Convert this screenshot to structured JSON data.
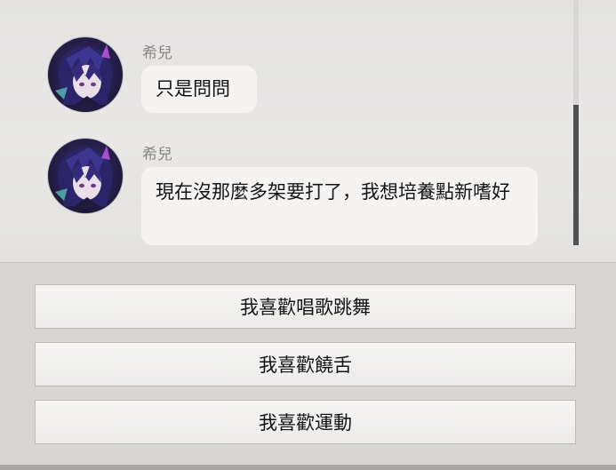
{
  "messages": [
    {
      "sender": "希兒",
      "text": "只是問問",
      "avatar_icon": "character-avatar"
    },
    {
      "sender": "希兒",
      "text": "現在沒那麼多架要打了，我想培養點新嗜好",
      "avatar_icon": "character-avatar"
    }
  ],
  "options": [
    {
      "label": "我喜歡唱歌跳舞"
    },
    {
      "label": "我喜歡饒舌"
    },
    {
      "label": "我喜歡運動"
    }
  ],
  "colors": {
    "bubble_bg": "#f5f4f3",
    "chat_bg": "#e6e5e4",
    "option_bg": "#f3f2f1",
    "scrollbar_thumb": "#505050",
    "sender_text": "#8a8886"
  }
}
